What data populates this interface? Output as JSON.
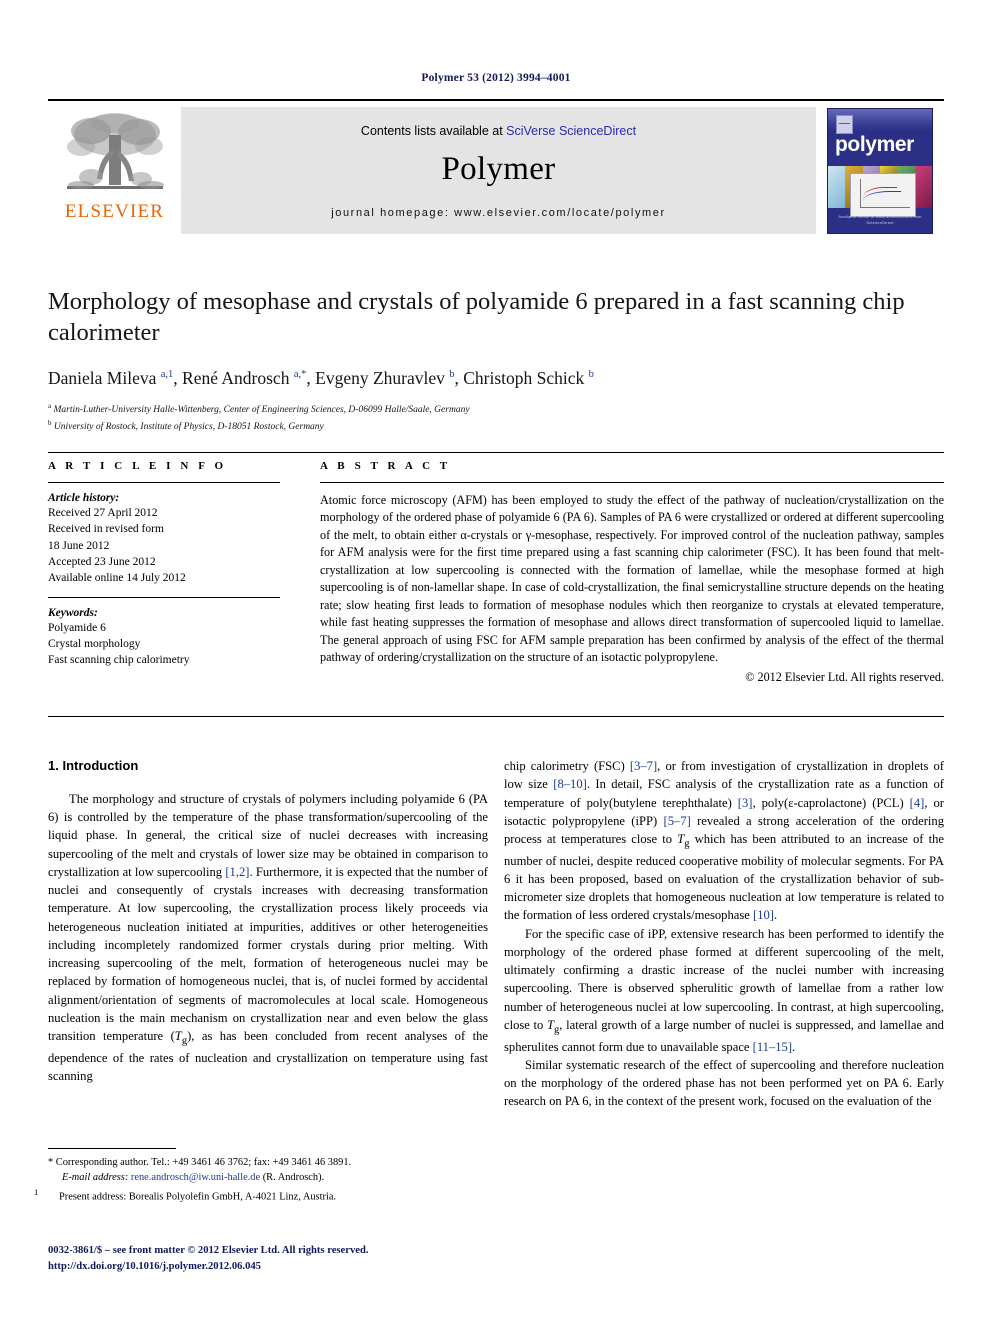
{
  "running_head": "Polymer 53 (2012) 3994–4001",
  "journal_header": {
    "publisher_logo_text": "ELSEVIER",
    "contents_prefix": "Contents lists available at ",
    "contents_link": "SciVerse ScienceDirect",
    "journal_name": "Polymer",
    "homepage_line": "journal homepage: www.elsevier.com/locate/polymer",
    "cover": {
      "title": "polymer",
      "footer_line_1": "ScienceDirect",
      "footer_line_2": "Available online at www.sciencedirect.com"
    }
  },
  "article": {
    "title": "Morphology of mesophase and crystals of polyamide 6 prepared in a fast scanning chip calorimeter",
    "authors_html": "Daniela Mileva <sup>a,1</sup>, René Androsch <sup>a,*</sup>, Evgeny Zhuravlev <sup>b</sup>, Christoph Schick <sup>b</sup>",
    "affiliation_a": "Martin-Luther-University Halle-Wittenberg, Center of Engineering Sciences, D-06099 Halle/Saale, Germany",
    "affiliation_b": "University of Rostock, Institute of Physics, D-18051 Rostock, Germany"
  },
  "article_info": {
    "heading": "A R T I C L E   I N F O",
    "history_label": "Article history:",
    "history": [
      "Received 27 April 2012",
      "Received in revised form",
      "18 June 2012",
      "Accepted 23 June 2012",
      "Available online 14 July 2012"
    ],
    "keywords_label": "Keywords:",
    "keywords": [
      "Polyamide 6",
      "Crystal morphology",
      "Fast scanning chip calorimetry"
    ]
  },
  "abstract": {
    "heading": "A B S T R A C T",
    "text": "Atomic force microscopy (AFM) has been employed to study the effect of the pathway of nucleation/crystallization on the morphology of the ordered phase of polyamide 6 (PA 6). Samples of PA 6 were crystallized or ordered at different supercooling of the melt, to obtain either α-crystals or γ-mesophase, respectively. For improved control of the nucleation pathway, samples for AFM analysis were for the first time prepared using a fast scanning chip calorimeter (FSC). It has been found that melt-crystallization at low supercooling is connected with the formation of lamellae, while the mesophase formed at high supercooling is of non-lamellar shape. In case of cold-crystallization, the final semicrystalline structure depends on the heating rate; slow heating first leads to formation of mesophase nodules which then reorganize to crystals at elevated temperature, while fast heating suppresses the formation of mesophase and allows direct transformation of supercooled liquid to lamellae. The general approach of using FSC for AFM sample preparation has been confirmed by analysis of the effect of the thermal pathway of ordering/crystallization on the structure of an isotactic polypropylene.",
    "copyright": "© 2012 Elsevier Ltd. All rights reserved."
  },
  "introduction": {
    "section_title": "1. Introduction",
    "left_paragraphs": [
      "The morphology and structure of crystals of polymers including polyamide 6 (PA 6) is controlled by the temperature of the phase transformation/supercooling of the liquid phase. In general, the critical size of nuclei decreases with increasing supercooling of the melt and crystals of lower size may be obtained in comparison to crystallization at low supercooling [1,2]. Furthermore, it is expected that the number of nuclei and consequently of crystals increases with decreasing transformation temperature. At low supercooling, the crystallization process likely proceeds via heterogeneous nucleation initiated at impurities, additives or other heterogeneities including incompletely randomized former crystals during prior melting. With increasing supercooling of the melt, formation of heterogeneous nuclei may be replaced by formation of homogeneous nuclei, that is, of nuclei formed by accidental alignment/orientation of segments of macromolecules at local scale. Homogeneous nucleation is the main mechanism on crystallization near and even below the glass transition temperature (Tg), as has been concluded from recent analyses of the dependence of the rates of nucleation and crystallization on temperature using fast scanning"
    ],
    "right_paragraphs": [
      "chip calorimetry (FSC) [3–7], or from investigation of crystallization in droplets of low size [8–10]. In detail, FSC analysis of the crystallization rate as a function of temperature of poly(butylene terephthalate) [3], poly(ε-caprolactone) (PCL) [4], or isotactic polypropylene (iPP) [5–7] revealed a strong acceleration of the ordering process at temperatures close to Tg which has been attributed to an increase of the number of nuclei, despite reduced cooperative mobility of molecular segments. For PA 6 it has been proposed, based on evaluation of the crystallization behavior of sub-micrometer size droplets that homogeneous nucleation at low temperature is related to the formation of less ordered crystals/mesophase [10].",
      "For the specific case of iPP, extensive research has been performed to identify the morphology of the ordered phase formed at different supercooling of the melt, ultimately confirming a drastic increase of the nuclei number with increasing supercooling. There is observed spherulitic growth of lamellae from a rather low number of heterogeneous nuclei at low supercooling. In contrast, at high supercooling, close to Tg, lateral growth of a large number of nuclei is suppressed, and lamellae and spherulites cannot form due to unavailable space [11–15].",
      "Similar systematic research of the effect of supercooling and therefore nucleation on the morphology of the ordered phase has not been performed yet on PA 6. Early research on PA 6, in the context of the present work, focused on the evaluation of the"
    ]
  },
  "footnotes": {
    "corresponding": "* Corresponding author. Tel.: +49 3461 46 3762; fax: +49 3461 46 3891.",
    "email_label": "E-mail address:",
    "email": "rene.androsch@iw.uni-halle.de",
    "email_suffix": "(R. Androsch).",
    "present_address_marker": "1",
    "present_address": "Present address: Borealis Polyolefin GmbH, A-4021 Linz, Austria."
  },
  "imprint": {
    "issn_line": "0032-3861/$ – see front matter © 2012 Elsevier Ltd. All rights reserved.",
    "doi": "http://dx.doi.org/10.1016/j.polymer.2012.06.045"
  },
  "colors": {
    "heading_navy": "#12195b",
    "link_blue": "#1b3b8f",
    "elsevier_orange": "#ec6608",
    "cover_navy": "#2b2f86",
    "band_gray": "#e4e4e4"
  }
}
